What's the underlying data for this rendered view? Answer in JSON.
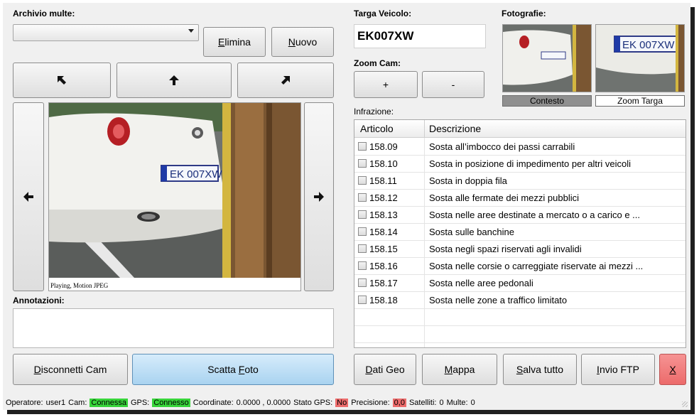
{
  "archive": {
    "label": "Archivio multe:",
    "value": ""
  },
  "buttons": {
    "elimina_pre": "",
    "elimina_acc": "E",
    "elimina_post": "limina",
    "nuovo_pre": "",
    "nuovo_acc": "N",
    "nuovo_post": "uovo",
    "disconnetti_pre": "",
    "disconnetti_acc": "D",
    "disconnetti_post": "isconnetti Cam",
    "scatta_pre": "Scatta ",
    "scatta_acc": "F",
    "scatta_post": "oto",
    "datigeo_pre": "",
    "datigeo_acc": "D",
    "datigeo_post": "ati Geo",
    "mappa_pre": "",
    "mappa_acc": "M",
    "mappa_post": "appa",
    "salva_pre": "",
    "salva_acc": "S",
    "salva_post": "alva tutto",
    "invio_pre": "",
    "invio_acc": "I",
    "invio_post": "nvio FTP",
    "close_acc": "X",
    "zoom_in": "+",
    "zoom_out": "-"
  },
  "camera": {
    "status_text": "Playing, Motion JPEG",
    "plate_text": "EK 007XW"
  },
  "annotazioni": {
    "label": "Annotazioni:",
    "value": ""
  },
  "targa": {
    "label": "Targa Veicolo:",
    "value": "EK007XW"
  },
  "zoom": {
    "label": "Zoom Cam:"
  },
  "fotografie": {
    "label": "Fotografie:",
    "contesto": "Contesto",
    "zoom_targa": "Zoom Targa",
    "plate_small": "EK 007XW"
  },
  "infrazione": {
    "label": "Infrazione:",
    "columns": [
      "Articolo",
      "Descrizione"
    ],
    "rows": [
      {
        "articolo": "158.09",
        "descrizione": "Sosta all’imbocco dei passi carrabili"
      },
      {
        "articolo": "158.10",
        "descrizione": "Sosta in posizione di impedimento per altri veicoli"
      },
      {
        "articolo": "158.11",
        "descrizione": "Sosta in doppia fila"
      },
      {
        "articolo": "158.12",
        "descrizione": "Sosta alle fermate dei mezzi pubblici"
      },
      {
        "articolo": "158.13",
        "descrizione": "Sosta nelle aree destinate a mercato o a carico e ..."
      },
      {
        "articolo": "158.14",
        "descrizione": "Sosta sulle banchine"
      },
      {
        "articolo": "158.15",
        "descrizione": "Sosta negli spazi riservati agli invalidi"
      },
      {
        "articolo": "158.16",
        "descrizione": "Sosta nelle corsie o carreggiate riservate ai mezzi ..."
      },
      {
        "articolo": "158.17",
        "descrizione": "Sosta nelle aree pedonali"
      },
      {
        "articolo": "158.18",
        "descrizione": "Sosta nelle zone a traffico limitato"
      }
    ]
  },
  "status": {
    "operatore_label": "Operatore:",
    "operatore_value": "user1",
    "cam_label": "Cam:",
    "cam_value": "Connessa",
    "gps_label": "GPS:",
    "gps_value": "Connesso",
    "coord_label": "Coordinate:",
    "coord_value": "0.0000 , 0.0000",
    "statogps_label": "Stato GPS:",
    "statogps_value": "No",
    "precisione_label": "Precisione:",
    "precisione_value": "0,0",
    "satelliti_label": "Satelliti:",
    "satelliti_value": "0",
    "multe_label": "Multe:",
    "multe_value": "0"
  },
  "colors": {
    "ok": "#37d43a",
    "error": "#ec6b6b",
    "scatta_bg": "#bfe0f6",
    "close_bg": "#f17878",
    "tab_active": "#8f8f8f"
  }
}
